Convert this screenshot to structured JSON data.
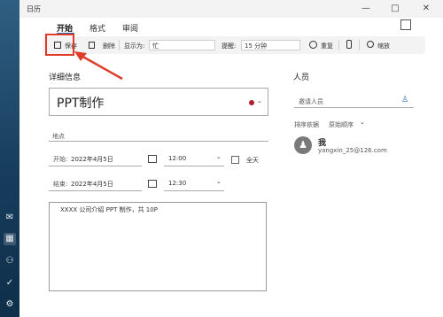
{
  "titlebar": {
    "title": "日历",
    "min": "—",
    "max": "□",
    "close": "✕"
  },
  "tabs": [
    {
      "label": "开始",
      "active": true
    },
    {
      "label": "格式",
      "active": false
    },
    {
      "label": "审阅",
      "active": false
    }
  ],
  "ribbon": {
    "save": "保存",
    "delete": "删除",
    "show_as_label": "显示为:",
    "show_as_value": "忙",
    "reminder_label": "提醒:",
    "reminder_value": "15 分钟",
    "repeat": "重复",
    "zoom": "缩放"
  },
  "details": {
    "heading": "详细信息",
    "subject": "PPT制作",
    "location_placeholder": "地点",
    "start_label": "开始:",
    "start_date": "2022年4月5日",
    "start_time": "12:00",
    "allday": "全天",
    "end_label": "结束:",
    "end_date": "2022年4月5日",
    "end_time": "12:30",
    "notes": "XXXX 公司介绍 PPT 制作，共 10P"
  },
  "people": {
    "heading": "人员",
    "invite_placeholder": "邀请人员",
    "sort_label": "排序依据",
    "sort_value": "原始顺序",
    "person_name": "我",
    "person_email": "yangxin_25@126.com"
  },
  "colors": {
    "accent": "#2b6cb0",
    "highlight": "#e03a2a",
    "calendar_dot": "#b0202a"
  }
}
